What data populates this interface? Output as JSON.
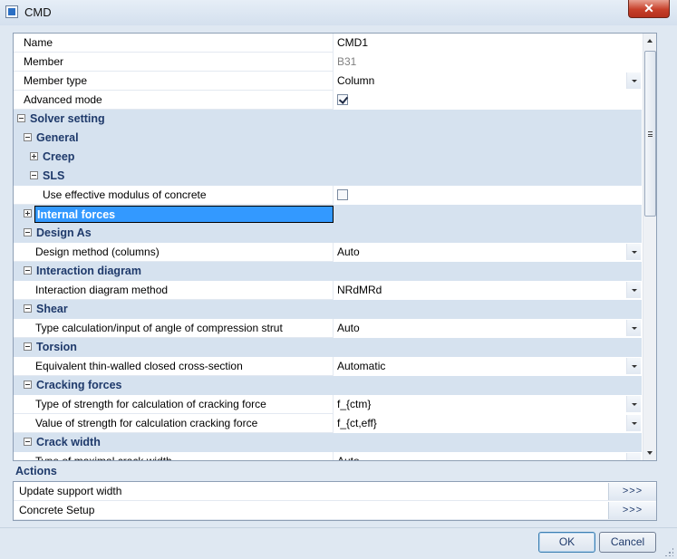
{
  "window": {
    "title": "CMD",
    "close_label": "✕"
  },
  "grid": {
    "rows": [
      {
        "kind": "prop",
        "label": "Name",
        "value": "CMD1",
        "editor": "text",
        "indent": 0
      },
      {
        "kind": "prop",
        "label": "Member",
        "value": "B31",
        "editor": "readonly",
        "indent": 0
      },
      {
        "kind": "prop",
        "label": "Member type",
        "value": "Column",
        "editor": "dropdown",
        "indent": 0
      },
      {
        "kind": "prop",
        "label": "Advanced mode",
        "checked": true,
        "editor": "checkbox",
        "indent": 0
      },
      {
        "kind": "category",
        "label": "Solver setting",
        "expanded": true,
        "indent": 0
      },
      {
        "kind": "category",
        "label": "General",
        "expanded": true,
        "indent": 1
      },
      {
        "kind": "category",
        "label": "Creep",
        "expanded": false,
        "indent": 2
      },
      {
        "kind": "category",
        "label": "SLS",
        "expanded": true,
        "indent": 2
      },
      {
        "kind": "prop",
        "label": "Use effective modulus of concrete",
        "checked": false,
        "editor": "checkbox",
        "indent": 3
      },
      {
        "kind": "category",
        "label": "Internal forces",
        "expanded": false,
        "indent": 1,
        "selected": true
      },
      {
        "kind": "category",
        "label": "Design As",
        "expanded": true,
        "indent": 1
      },
      {
        "kind": "prop",
        "label": "Design method (columns)",
        "value": "Auto",
        "editor": "dropdown",
        "indent": 2
      },
      {
        "kind": "category",
        "label": "Interaction diagram",
        "expanded": true,
        "indent": 1
      },
      {
        "kind": "prop",
        "label": "Interaction diagram method",
        "value": "NRdMRd",
        "editor": "dropdown",
        "indent": 2
      },
      {
        "kind": "category",
        "label": "Shear",
        "expanded": true,
        "indent": 1
      },
      {
        "kind": "prop",
        "label": "Type calculation/input of angle of compression strut",
        "value": "Auto",
        "editor": "dropdown",
        "indent": 2
      },
      {
        "kind": "category",
        "label": "Torsion",
        "expanded": true,
        "indent": 1
      },
      {
        "kind": "prop",
        "label": "Equivalent thin-walled closed cross-section",
        "value": "Automatic",
        "editor": "dropdown",
        "indent": 2
      },
      {
        "kind": "category",
        "label": "Cracking forces",
        "expanded": true,
        "indent": 1
      },
      {
        "kind": "prop",
        "label": "Type of strength for calculation of cracking force",
        "value": "f_{ctm}",
        "editor": "dropdown",
        "indent": 2
      },
      {
        "kind": "prop",
        "label": "Value of strength for calculation cracking force",
        "value": "f_{ct,eff}",
        "editor": "dropdown",
        "indent": 2
      },
      {
        "kind": "category",
        "label": "Crack width",
        "expanded": true,
        "indent": 1
      },
      {
        "kind": "prop",
        "label": "Type of maximal crack width",
        "value": "Auto",
        "editor": "dropdown",
        "indent": 2
      }
    ]
  },
  "actions": {
    "title": "Actions",
    "items": [
      {
        "label": "Update support width",
        "button": ">>>"
      },
      {
        "label": "Concrete Setup",
        "button": ">>>"
      }
    ]
  },
  "buttons": {
    "ok_label": "OK",
    "cancel_label": "Cancel"
  },
  "colors": {
    "category_bg": "#d6e2ef",
    "category_text": "#1f3a6b",
    "selection": "#3399ff"
  }
}
